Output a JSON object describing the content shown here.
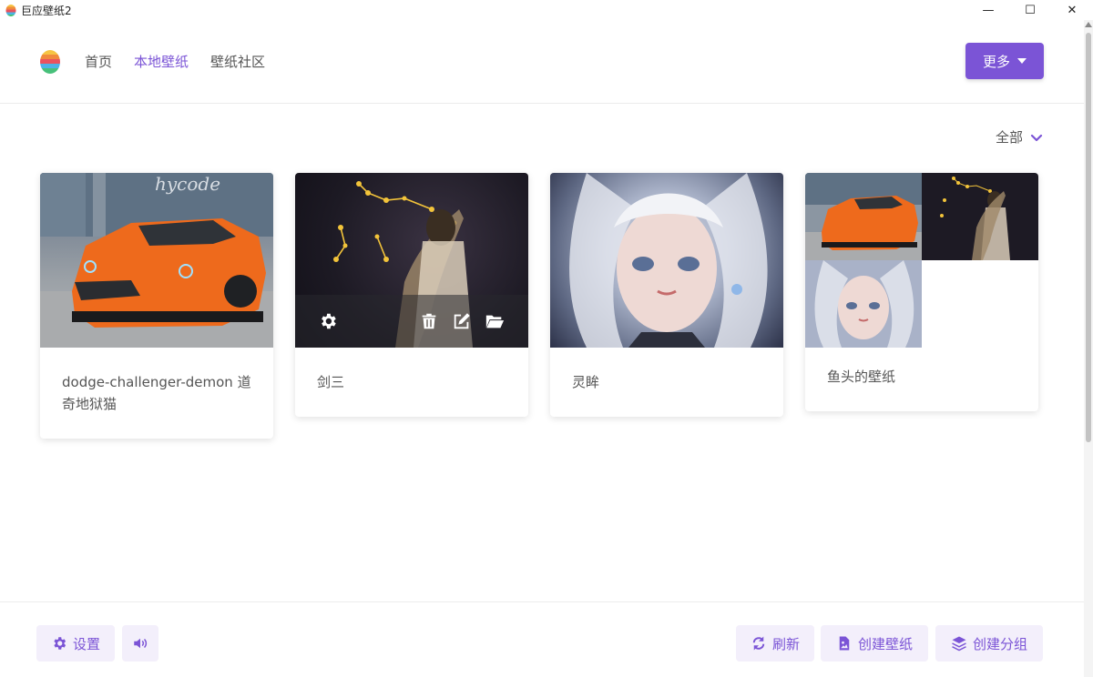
{
  "window": {
    "title": "巨应壁纸2",
    "controls": {
      "minimize": "—",
      "maximize": "☐",
      "close": "✕"
    }
  },
  "nav": {
    "items": [
      {
        "label": "首页",
        "active": false
      },
      {
        "label": "本地壁纸",
        "active": true
      },
      {
        "label": "壁纸社区",
        "active": false
      }
    ],
    "more_label": "更多"
  },
  "filter": {
    "label": "全部"
  },
  "cards": [
    {
      "name": "dodge-challenger-demon 道奇地狱猫",
      "watermark": "hycode"
    },
    {
      "name": "剑三"
    },
    {
      "name": "灵眸"
    },
    {
      "name": "鱼头的壁纸"
    }
  ],
  "footer": {
    "settings_label": "设置",
    "refresh_label": "刷新",
    "create_wallpaper_label": "创建壁纸",
    "create_group_label": "创建分组"
  },
  "colors": {
    "accent": "#7b54d6",
    "accent_light": "#f3effb",
    "text": "#555555"
  },
  "icons": {
    "logo": "rainbow-egg-icon",
    "gear": "gear-icon",
    "trash": "trash-icon",
    "edit": "edit-icon",
    "folder": "folder-open-icon",
    "volume": "volume-icon",
    "refresh": "refresh-icon",
    "file_image": "file-image-icon",
    "layers": "layers-icon",
    "chevron": "chevron-down-icon"
  }
}
